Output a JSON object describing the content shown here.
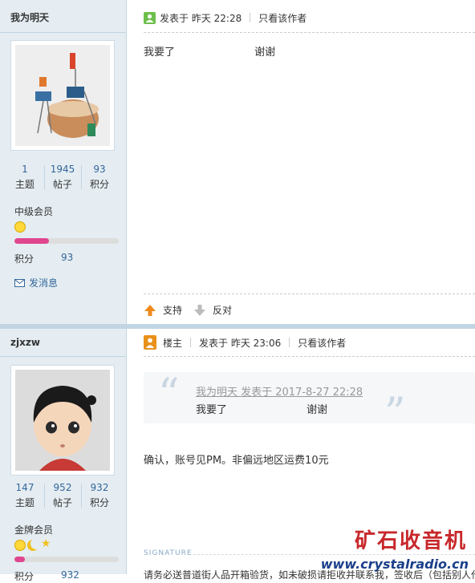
{
  "post1": {
    "author": "我为明天",
    "stats": [
      {
        "num": "1",
        "label": "主题"
      },
      {
        "num": "1945",
        "label": "帖子"
      },
      {
        "num": "93",
        "label": "积分"
      }
    ],
    "rank": "中级会员",
    "progress": 0.33,
    "points_label": "积分",
    "points_value": "93",
    "pm": "发消息",
    "posted": "发表于 昨天 22:28",
    "only_author": "只看该作者",
    "body": "我要了                        谢谢",
    "support": "支持",
    "oppose": "反对"
  },
  "post2": {
    "author": "zjxzw",
    "stats": [
      {
        "num": "147",
        "label": "主题"
      },
      {
        "num": "952",
        "label": "帖子"
      },
      {
        "num": "932",
        "label": "积分"
      }
    ],
    "rank": "金牌会员",
    "progress": 0.1,
    "points_label": "积分",
    "points_value": "932",
    "louzhu": "楼主",
    "posted": "发表于 昨天 23:06",
    "only_author": "只看该作者",
    "quote_header": "我为明天 发表于 2017-8-27 22:28",
    "quote_body": "我要了                        谢谢",
    "body": "确认，账号见PM。非偏远地区运费10元",
    "signature_label": "SIGNATURE",
    "sig_text": "请务必送普道街人品开箱验货，如未破损请拒收并联系我，签收后（包括别人代签）"
  },
  "watermark": {
    "title": "矿石收音机",
    "url": "www.crystalradio.cn"
  },
  "colors": {
    "accent": "#336699",
    "sidebar": "#e5edf2",
    "progress": "#e0468f"
  }
}
